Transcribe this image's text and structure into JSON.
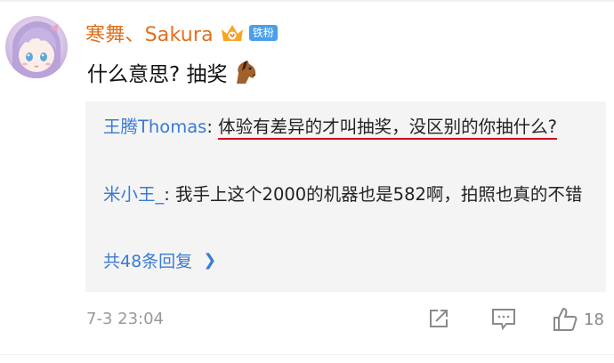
{
  "comment": {
    "username": "寒舞、Sakura",
    "fan_badge": "铁粉",
    "text": "什么意思? 抽奖",
    "timestamp": "7-3 23:04",
    "like_count": "18",
    "icons": {
      "avatar": "anime-girl-avatar",
      "vip": "vip-crown-icon",
      "emoji": "horse-emoji-icon",
      "share": "share-icon",
      "comment": "comment-icon",
      "like": "thumbs-up-icon"
    }
  },
  "replies": [
    {
      "user": "王腾Thomas",
      "separator": ": ",
      "text": "体验有差异的才叫抽奖，没区别的你抽什么?"
    },
    {
      "user": "米小王_",
      "separator": ": ",
      "text": "我手上这个2000的机器也是582啊，拍照也真的不错"
    }
  ],
  "more_replies": "共48条回复",
  "colors": {
    "username": "#e0701a",
    "link_blue": "#3a7bd5",
    "badge_blue": "#4a9fe8",
    "annotation_red": "#d0021b",
    "reply_bg": "#f4f4f4",
    "muted": "#999999"
  }
}
